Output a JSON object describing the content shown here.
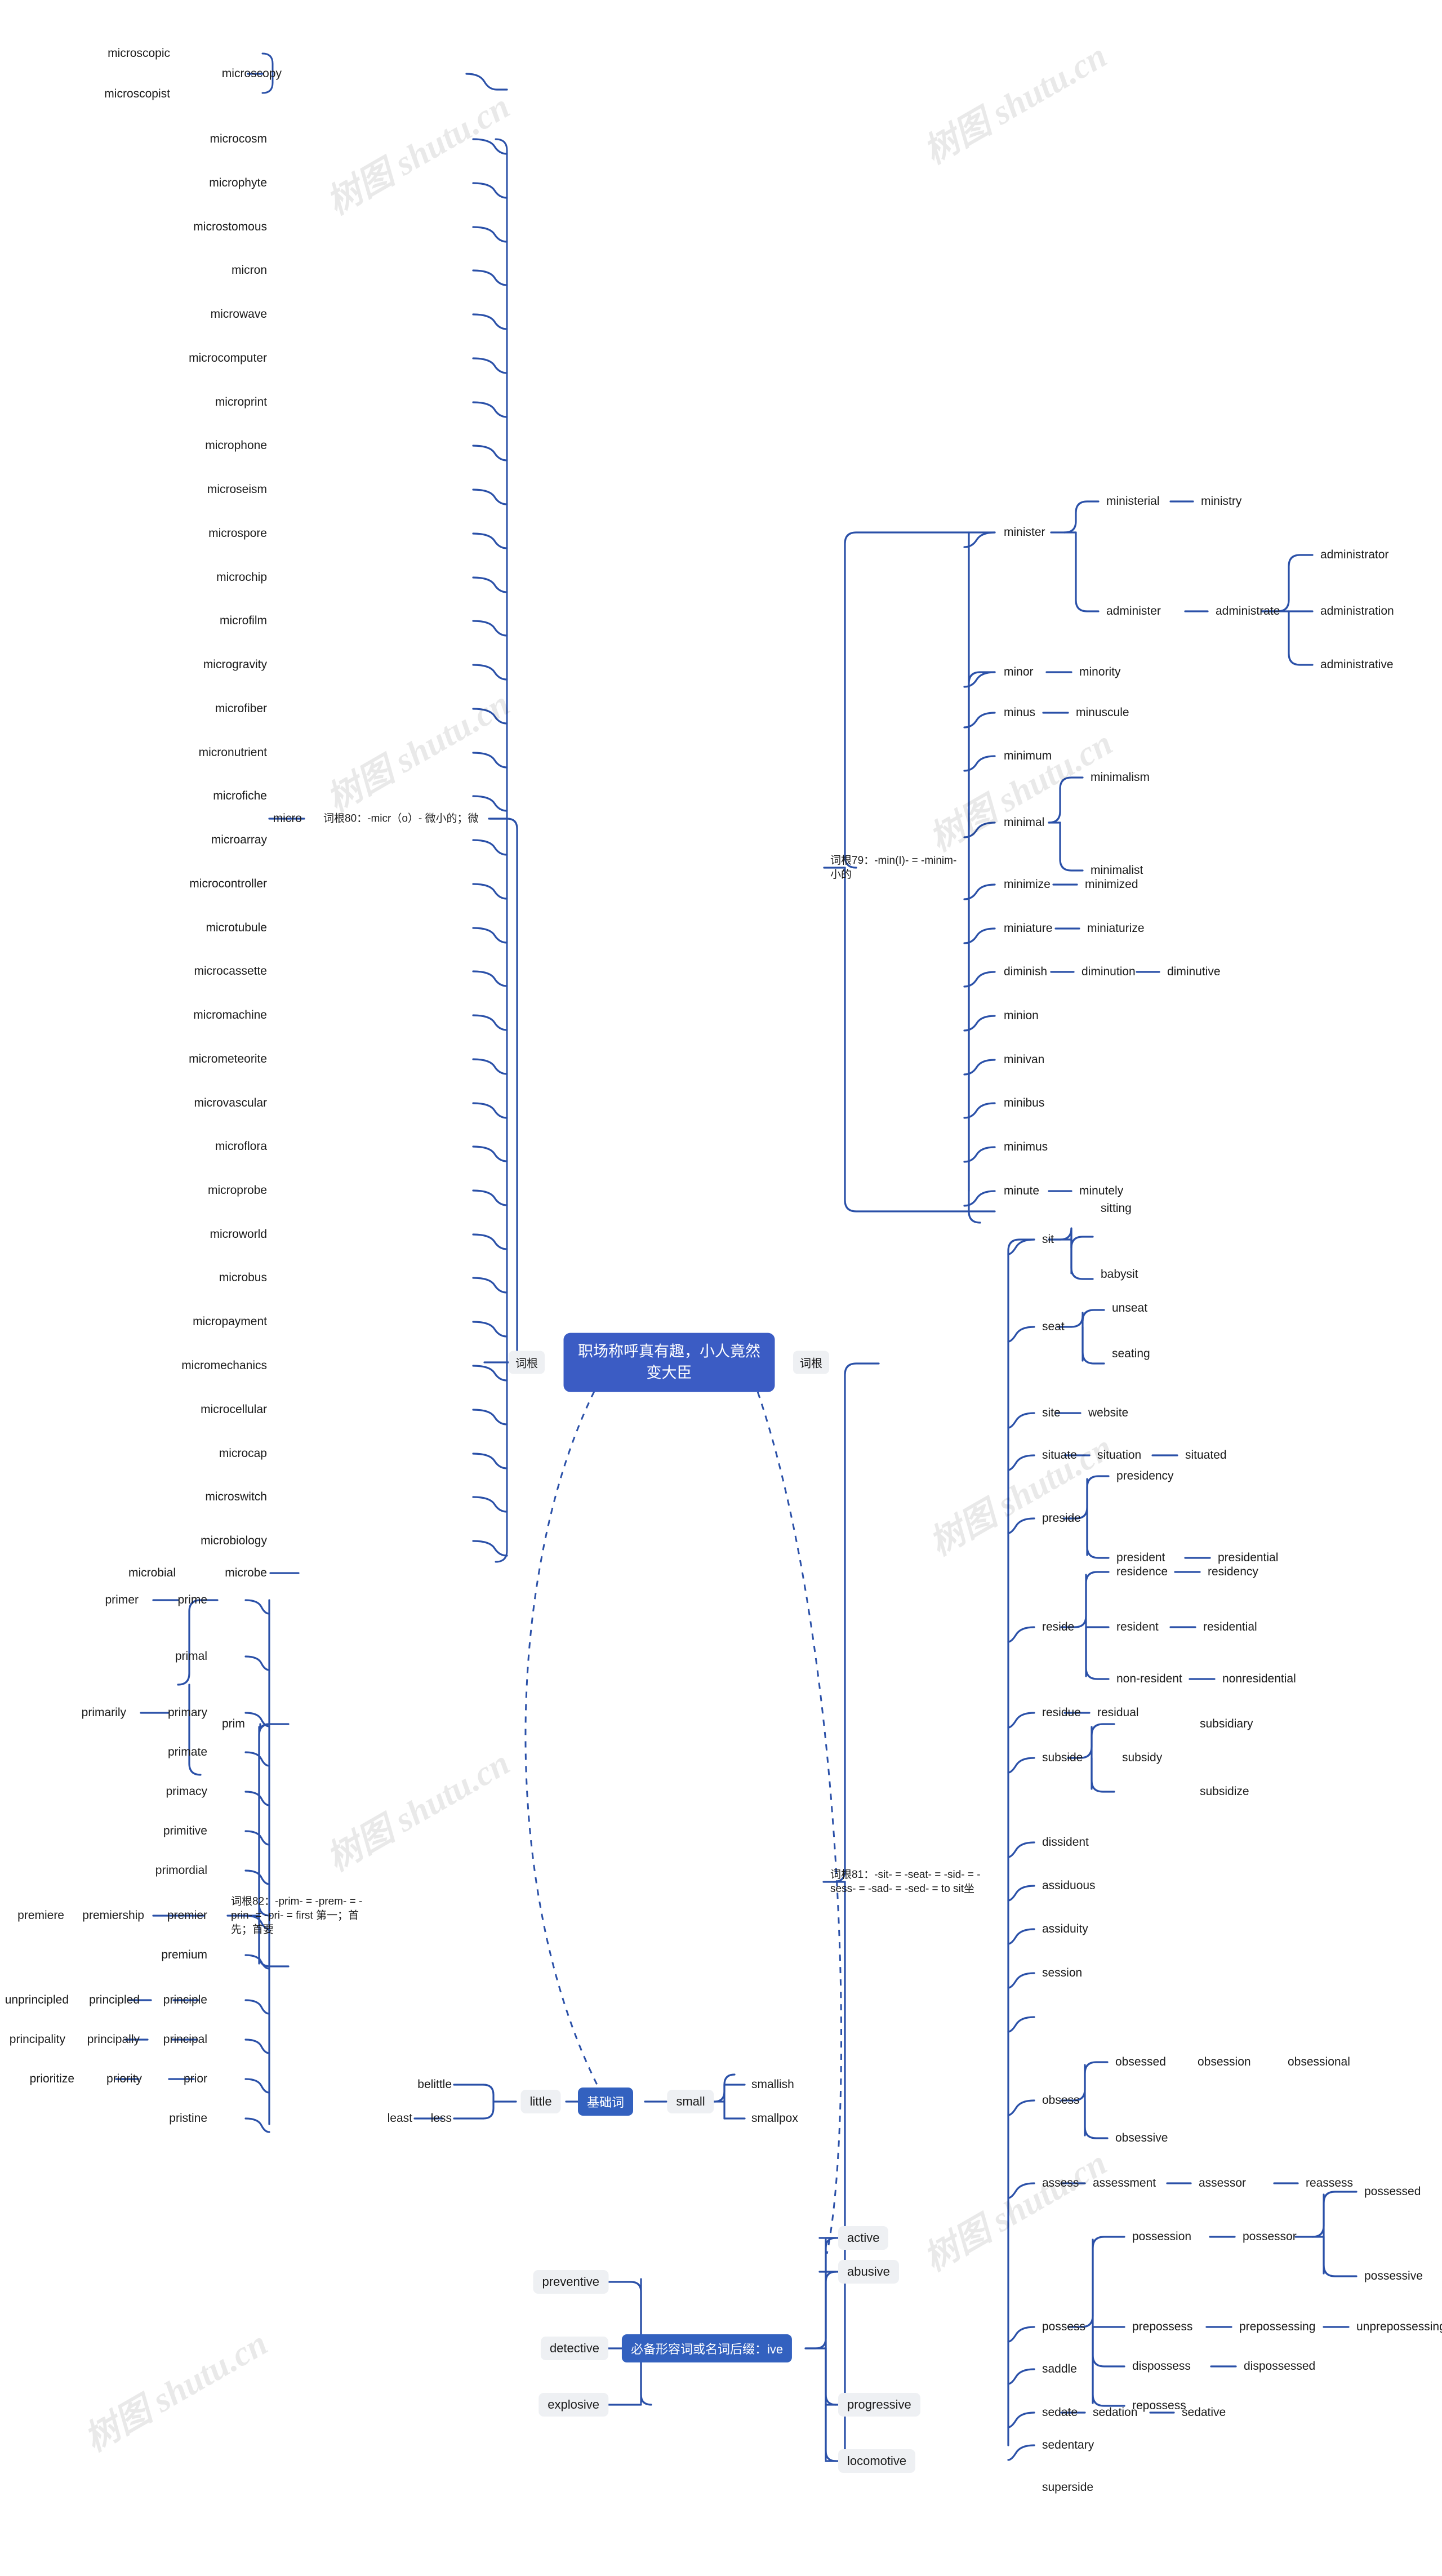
{
  "meta": {
    "watermark_text": "树图 shutu.cn",
    "accent_color": "#3b5cc4",
    "line_color": "#2a50a8",
    "chip_bg": "#eef0f3"
  },
  "root": {
    "title": "职场称呼真有趣，小人竟然变大臣"
  },
  "connector_labels": {
    "left_cigen": "词根",
    "right_cigen": "词根"
  },
  "branches": {
    "micro": {
      "label": "词根80：-micr（o）- 微小的；微",
      "stem": "micro",
      "leaves": [
        "microscopy",
        "microcosm",
        "microphyte",
        "microstomous",
        "micron",
        "microwave",
        "microcomputer",
        "microprint",
        "microphone",
        "microseism",
        "microspore",
        "microchip",
        "microfilm",
        "microgravity",
        "microfiber",
        "micronutrient",
        "microfiche",
        "microarray",
        "microcontroller",
        "microtubule",
        "microcassette",
        "micromachine",
        "micrometeorite",
        "microvascular",
        "microflora",
        "microprobe",
        "microworld",
        "microbus",
        "micropayment",
        "micromechanics",
        "microcellular",
        "microcap",
        "microswitch",
        "microbiology",
        "microbe"
      ],
      "sub": {
        "microscopy": [
          "microscopic",
          "microscopist"
        ],
        "microbe": [
          "microbial"
        ]
      }
    },
    "min": {
      "label": "词根79：-min(I)- = -minim- 小的",
      "leaves": [
        "minister",
        "minor",
        "minus",
        "minimum",
        "minimal",
        "minimize",
        "miniature",
        "diminish",
        "minion",
        "minivan",
        "minibus",
        "minimus",
        "minute"
      ],
      "sub": {
        "minister": [
          "ministerial",
          "administer"
        ],
        "ministerial": [
          "ministry"
        ],
        "administer": [
          "administrate"
        ],
        "administrate": [
          "administrator",
          "administration",
          "administrative"
        ],
        "minor": [
          "minority"
        ],
        "minus": [
          "minuscule"
        ],
        "minimal": [
          "minimalism",
          "minimalist"
        ],
        "minimize": [
          "minimized"
        ],
        "miniature": [
          "miniaturize"
        ],
        "diminish": [
          "diminution"
        ],
        "diminution": [
          "diminutive"
        ],
        "minute": [
          "minutely"
        ]
      }
    },
    "sit": {
      "label": "词根81：-sit- = -seat- = -sid- = -sess- = -sad- = -sed- = to sit坐",
      "leaves": [
        "sit",
        "seat",
        "site",
        "situate",
        "preside",
        "reside",
        "residue",
        "subside",
        "dissident",
        "assiduous",
        "assiduity",
        "session",
        "obsess",
        "assess",
        "possess",
        "saddle",
        "sedate",
        "sedentary",
        "superside"
      ],
      "sub": {
        "sit": [
          "sitting",
          "babysit"
        ],
        "seat": [
          "unseat",
          "seating"
        ],
        "site": [
          "website"
        ],
        "situate": [
          "situation"
        ],
        "situation": [
          "situated"
        ],
        "preside": [
          "presidency",
          "president"
        ],
        "president": [
          "presidential"
        ],
        "reside": [
          "residence",
          "resident",
          "non-resident"
        ],
        "residence": [
          "residency"
        ],
        "resident": [
          "residential"
        ],
        "non-resident": [
          "nonresidential"
        ],
        "residue": [
          "residual"
        ],
        "subside": [
          "subsidy"
        ],
        "subsidy": [
          "subsidiary",
          "subsidize"
        ],
        "obsess": [
          "obsessed",
          "obsessive"
        ],
        "obsessed": [
          "obsession"
        ],
        "obsession": [
          "obsessional"
        ],
        "assess": [
          "assessment"
        ],
        "assessment": [
          "assessor"
        ],
        "assessor": [
          "reassess"
        ],
        "possess": [
          "possession",
          "prepossess",
          "dispossess",
          "repossess"
        ],
        "possession": [
          "possessor"
        ],
        "possessor": [
          "possessed",
          "possessive"
        ],
        "prepossess": [
          "prepossessing"
        ],
        "prepossessing": [
          "unprepossessing"
        ],
        "dispossess": [
          "dispossessed"
        ],
        "sedate": [
          "sedation"
        ],
        "sedation": [
          "sedative"
        ]
      }
    },
    "prim": {
      "label": "词根82：-prim- = -prem- = -prin- = -pri- = first 第一；首先；首要",
      "stem": "prim",
      "leaves": [
        "prime",
        "primal",
        "primary",
        "primate",
        "primacy",
        "primitive",
        "primordial",
        "premier",
        "premium",
        "principle",
        "principal",
        "prior",
        "pristine"
      ],
      "sub": {
        "prime": [
          "primer"
        ],
        "primary": [
          "primarily"
        ],
        "premier": [
          "premiership"
        ],
        "premiership": [
          "premiere"
        ],
        "principle": [
          "principled"
        ],
        "principled": [
          "unprincipled"
        ],
        "principal": [
          "principally"
        ],
        "principally": [
          "principality"
        ],
        "prior": [
          "priority"
        ],
        "priority": [
          "prioritize"
        ]
      }
    },
    "basic": {
      "label": "基础词",
      "left_stem": "little",
      "right_stem": "small",
      "left_leaves": [
        "belittle",
        "less"
      ],
      "left_sub": {
        "less": [
          "least"
        ]
      },
      "right_leaves": [
        "smallish",
        "smallpox"
      ]
    },
    "ive": {
      "label": "必备形容词或名词后缀：ive",
      "left_leaves": [
        "preventive",
        "detective",
        "explosive"
      ],
      "right_leaves": [
        "active",
        "abusive",
        "progressive",
        "locomotive"
      ]
    }
  }
}
